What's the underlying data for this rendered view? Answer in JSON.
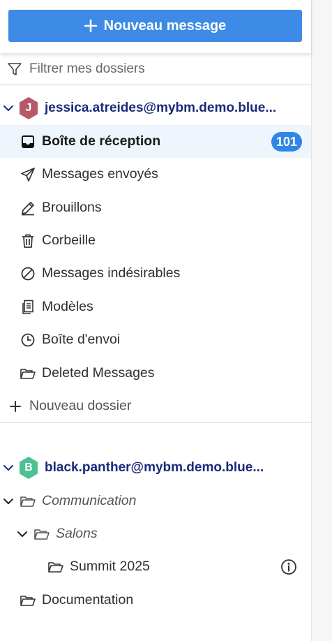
{
  "toolbar": {
    "new_message_label": "Nouveau message"
  },
  "filter": {
    "placeholder": "Filtrer mes dossiers"
  },
  "accounts": [
    {
      "initial": "J",
      "avatar_color": "#b65a6a",
      "email": "jessica.atreides@mybm.demo.blue...",
      "folders": [
        {
          "label": "Boîte de réception",
          "icon": "inbox-icon",
          "selected": true,
          "unread": "101"
        },
        {
          "label": "Messages envoyés",
          "icon": "send-icon"
        },
        {
          "label": "Brouillons",
          "icon": "pencil-icon"
        },
        {
          "label": "Corbeille",
          "icon": "trash-icon"
        },
        {
          "label": "Messages indésirables",
          "icon": "forbidden-icon"
        },
        {
          "label": "Modèles",
          "icon": "templates-icon"
        },
        {
          "label": "Boîte d'envoi",
          "icon": "clock-icon"
        },
        {
          "label": "Deleted Messages",
          "icon": "folder-icon"
        }
      ],
      "new_folder_label": "Nouveau dossier"
    },
    {
      "initial": "B",
      "avatar_color": "#4fbf95",
      "email": "black.panther@mybm.demo.blue...",
      "folders": [
        {
          "label": "Communication",
          "icon": "folder-icon",
          "expanded": true
        },
        {
          "label": "Salons",
          "icon": "folder-icon",
          "expanded": true
        },
        {
          "label": "Summit 2025",
          "icon": "folder-icon"
        },
        {
          "label": "Documentation",
          "icon": "folder-icon"
        }
      ]
    }
  ],
  "colors": {
    "accent": "#3d8be6",
    "badge": "#2f86e6",
    "account_text": "#1b2a7a",
    "selected_bg": "#eef5fd"
  }
}
